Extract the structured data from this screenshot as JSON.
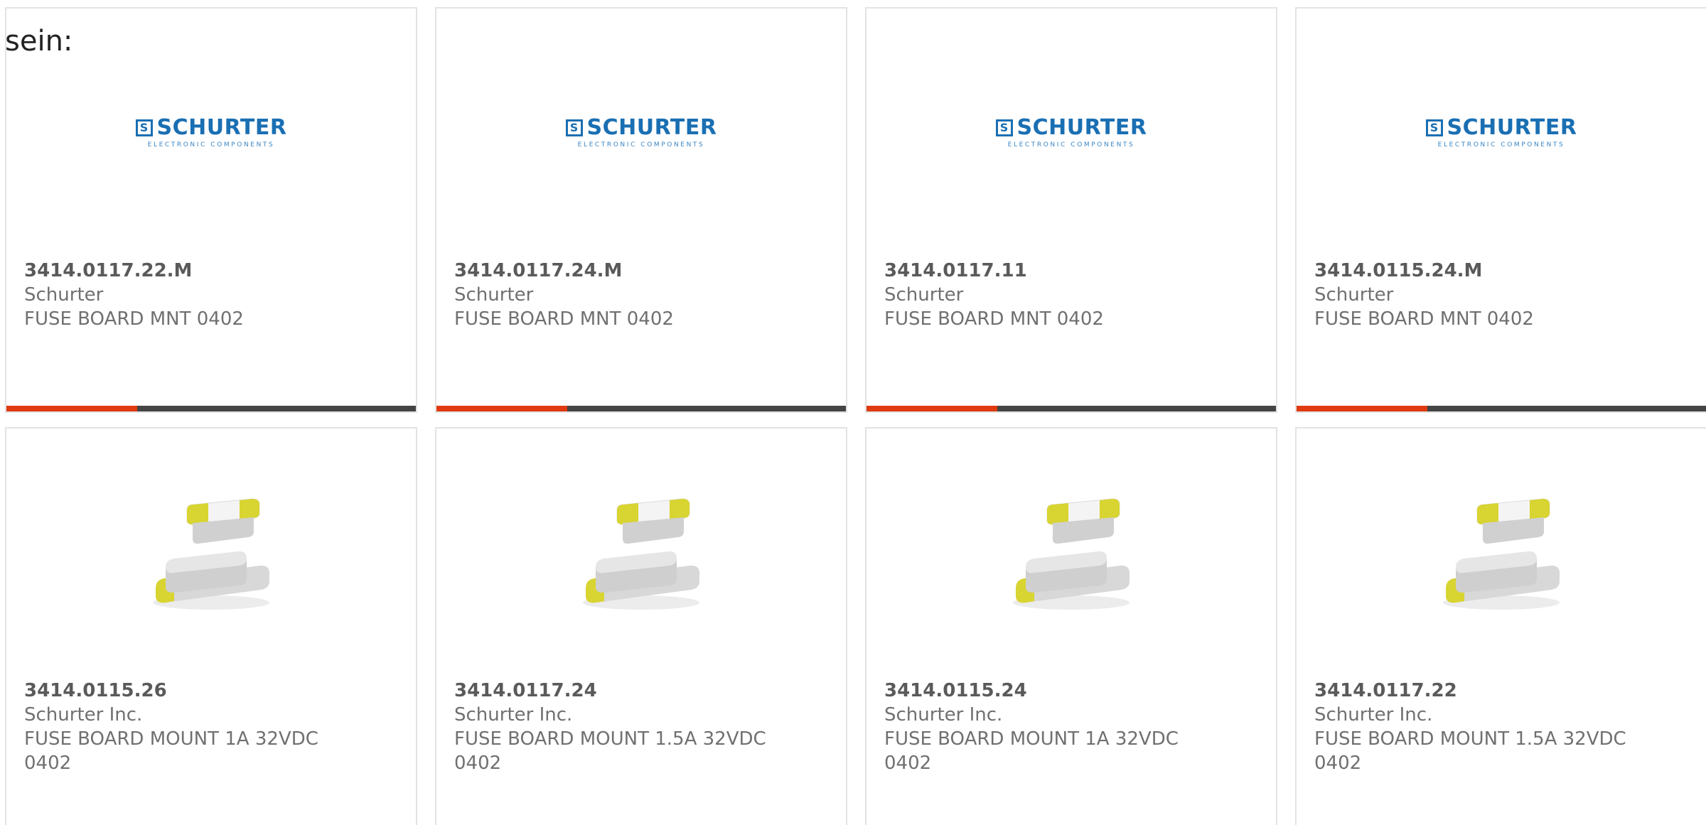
{
  "intro_text": "sein:",
  "row1": [
    {
      "part_no": "3414.0117.22.M",
      "manufacturer": "Schurter",
      "description": "FUSE BOARD MNT 0402",
      "image": "schurter-logo",
      "progress": 0.32
    },
    {
      "part_no": "3414.0117.24.M",
      "manufacturer": "Schurter",
      "description": "FUSE BOARD MNT 0402",
      "image": "schurter-logo",
      "progress": 0.32
    },
    {
      "part_no": "3414.0117.11",
      "manufacturer": "Schurter",
      "description": "FUSE BOARD MNT 0402",
      "image": "schurter-logo",
      "progress": 0.32
    },
    {
      "part_no": "3414.0115.24.M",
      "manufacturer": "Schurter",
      "description": "FUSE BOARD MNT 0402",
      "image": "schurter-logo",
      "progress": 0.32
    }
  ],
  "row2": [
    {
      "part_no": "3414.0115.26",
      "manufacturer": "Schurter Inc.",
      "description": "FUSE BOARD MOUNT 1A 32VDC 0402",
      "image": "smd-fuse-photo"
    },
    {
      "part_no": "3414.0117.24",
      "manufacturer": "Schurter Inc.",
      "description": "FUSE BOARD MOUNT 1.5A 32VDC 0402",
      "image": "smd-fuse-photo"
    },
    {
      "part_no": "3414.0115.24",
      "manufacturer": "Schurter Inc.",
      "description": "FUSE BOARD MOUNT 1A 32VDC 0402",
      "image": "smd-fuse-photo"
    },
    {
      "part_no": "3414.0117.22",
      "manufacturer": "Schurter Inc.",
      "description": "FUSE BOARD MOUNT 1.5A 32VDC 0402",
      "image": "smd-fuse-photo"
    }
  ],
  "logo": {
    "mark": "S",
    "name": "SCHURTER",
    "subtitle": "ELECTRONIC COMPONENTS"
  },
  "colors": {
    "brand_blue": "#1a6fb3",
    "progress_fill": "#e03a10",
    "progress_track": "#444444",
    "card_border": "#e3e3e3",
    "text_gray": "#666666",
    "fuse_yellow": "#d8d431"
  }
}
